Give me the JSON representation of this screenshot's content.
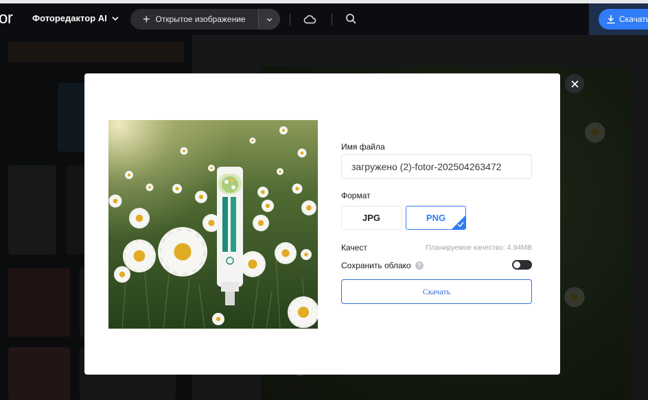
{
  "app": {
    "brand": "or",
    "editor_menu_label": "Фоторедактор AI",
    "open_image_label": "Открытое изображение",
    "download_label": "Скачать"
  },
  "icons": {
    "menu_chevron": "chevron-down-icon",
    "open_plus": "plus-icon",
    "open_dropdown": "chevron-down-icon",
    "cloud": "cloud-icon",
    "search": "search-icon",
    "download": "download-icon",
    "close": "close-icon",
    "help": "help-icon",
    "check": "check-icon"
  },
  "dialog": {
    "file_name_label": "Имя файла",
    "file_name_value": "загружено (2)-fotor-202504263472",
    "format_label": "Формат",
    "formats": [
      "JPG",
      "PNG"
    ],
    "selected_format": "PNG",
    "quality_label": "Качест",
    "quality_estimate": "Планируемое качество: 4.94MB",
    "save_cloud_label": "Сохранить облако",
    "save_cloud_enabled": false,
    "help_glyph": "?",
    "download_button_label": "Скачать"
  },
  "colors": {
    "accent": "#2f7cf6",
    "topbar_bg": "#0c0d10",
    "modal_bg": "#ffffff",
    "toggle_off": "#2d2e33"
  }
}
